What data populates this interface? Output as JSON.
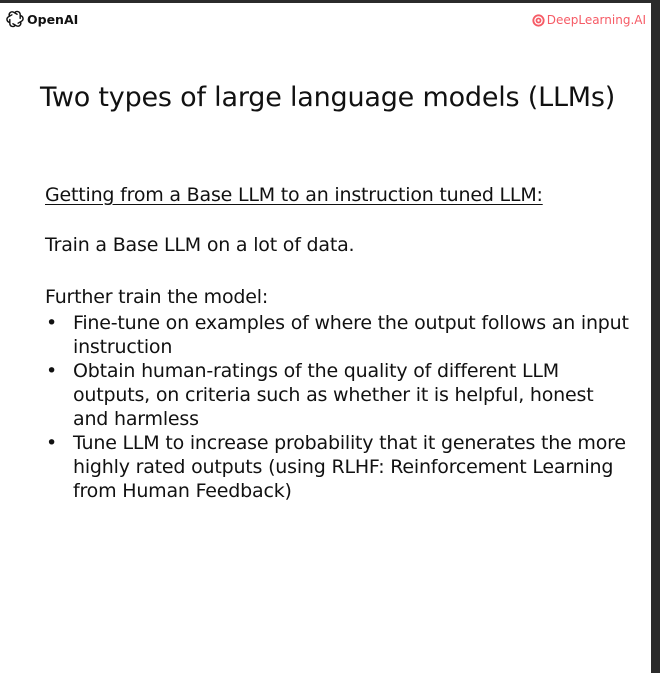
{
  "header": {
    "left_logo_text": "OpenAI",
    "left_logo_icon": "openai-logo-icon",
    "right_logo_text": "DeepLearning.AI",
    "right_logo_icon": "deeplearning-ai-logo-icon",
    "right_logo_color": "#f65b66"
  },
  "slide": {
    "title": "Two types of large language models (LLMs)",
    "subtitle": "Getting from a Base LLM to an instruction tuned LLM:",
    "paragraph1": "Train a Base LLM on a lot of data.",
    "paragraph2": "Further train the model:",
    "bullets": [
      "Fine-tune on examples of where the output follows an input instruction",
      "Obtain human-ratings of the quality of different LLM outputs, on criteria such as whether it is helpful, honest and harmless",
      "Tune LLM to increase probability that it generates the more highly rated outputs (using RLHF: Reinforcement Learning from Human Feedback)"
    ]
  }
}
